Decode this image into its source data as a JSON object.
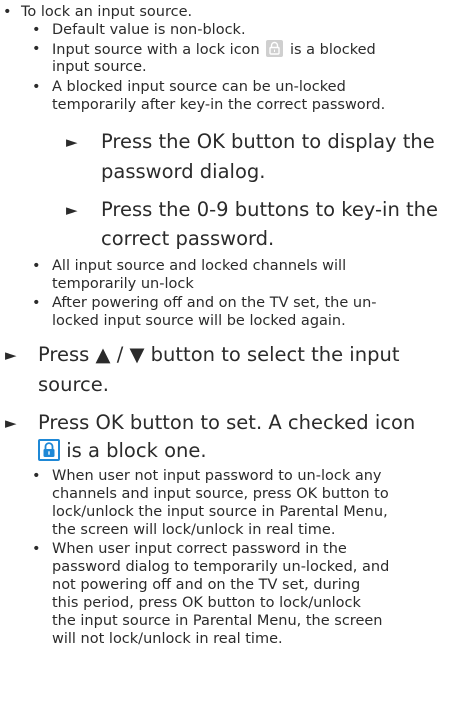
{
  "lines": {
    "l1": "To lock an input source.",
    "l2": "Default value is non-block.",
    "l3a": "Input source with a lock icon",
    "l3b": "is a blocked",
    "l3c": "input source.",
    "l4a": "A blocked input source can be un-locked",
    "l4b": "temporarily after key-in the correct password.",
    "l5a": "Press the OK button to display the",
    "l5b": "password dialog.",
    "l6a": "Press the 0-9 buttons to key-in the",
    "l6b": "correct password.",
    "l7a": "All input source and locked channels will",
    "l7b": "temporarily un-lock",
    "l8a": "After powering off and on the TV set, the un-",
    "l8b": "locked input source will be locked again.",
    "l9a": "Press ▲ / ▼ button to select the input",
    "l9b": "source.",
    "l10a": "Press OK button to set. A checked icon",
    "l10b": "is a block one.",
    "l11a": "When user not input password to un-lock any",
    "l11b": "channels and input source, press OK button to",
    "l11c": "lock/unlock the input source in Parental Menu,",
    "l11d": "the screen will lock/unlock in real time.",
    "l12a": "When user input correct password in the",
    "l12b": "password dialog to temporarily un-locked, and",
    "l12c": "not powering off and on the TV set, during",
    "l12d": "this period, press OK button to lock/unlock",
    "l12e": "the input source in Parental Menu, the screen",
    "l12f": "will not lock/unlock in real time."
  },
  "glyphs": {
    "bullet": "•",
    "arrow": "►"
  },
  "colors": {
    "text": "#2b2b2b",
    "lock_gray": "#cfcfcf",
    "lock_blue": "#1e88d6"
  },
  "icons": {
    "gray_lock": "padlock-gray-icon",
    "blue_lock": "padlock-checked-icon"
  }
}
